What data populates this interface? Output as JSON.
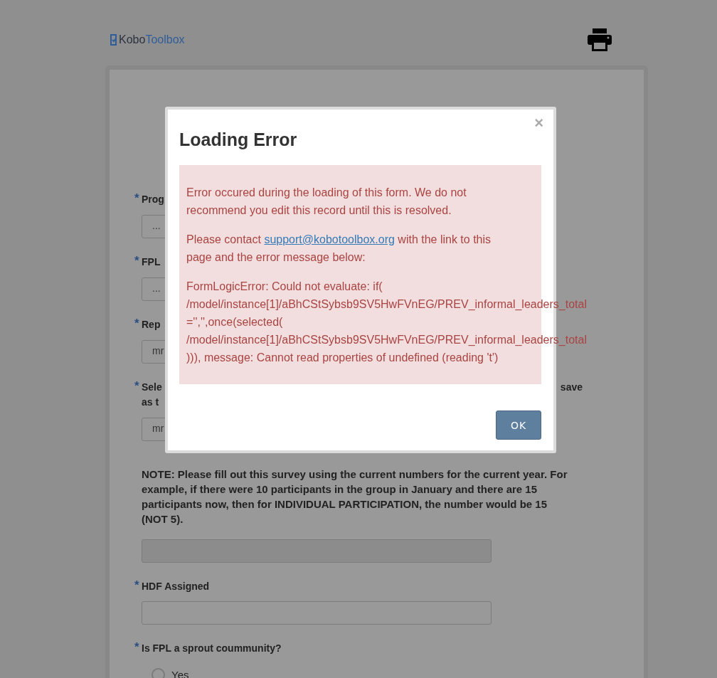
{
  "header": {
    "logo": {
      "part_1": "Kobo",
      "part_2": "Toolbox"
    }
  },
  "form": {
    "questions": [
      {
        "kind": "select",
        "required_mark": "*",
        "label_lines": [
          "Prog"
        ],
        "value": "..."
      },
      {
        "kind": "select",
        "required_mark": "*",
        "label_lines": [
          "FPL"
        ],
        "value": "..."
      },
      {
        "kind": "select",
        "required_mark": "*",
        "label_lines": [
          "Rep"
        ],
        "value": "mr"
      },
      {
        "kind": "select",
        "required_mark": "*",
        "label_lines": [
          "Sele",
          "as t"
        ],
        "label_right": "save",
        "value": "mr"
      },
      {
        "kind": "note",
        "label_lines": [
          "NOTE: Please fill out this survey using the current numbers for the current year. For example, if there were 10 participants in the group in January and there are 15 participants now, then for INDIVIDUAL PARTICIPATION, the number would be 15 (NOT 5)."
        ]
      },
      {
        "kind": "text",
        "required_mark": "*",
        "label_lines": [
          "HDF Assigned"
        ]
      },
      {
        "kind": "radio",
        "required_mark": "*",
        "label_lines": [
          "Is FPL a sprout coummunity?"
        ],
        "options": [
          {
            "label": "Yes",
            "selected": false
          }
        ]
      }
    ]
  },
  "dialog": {
    "title": "Loading Error",
    "close": "×",
    "paragraphs": [
      {
        "kind": "text",
        "text": "Error occured during the loading of this form. We do not recommend you edit this record until this is resolved."
      },
      {
        "kind": "link",
        "before": "Please contact ",
        "link": "support@kobotoolbox.org",
        "after": " with the link to this page and the error message below:"
      },
      {
        "kind": "code",
        "text": "FormLogicError: Could not evaluate: if( /model/instance[1]/aBhCStSybsb9SV5HwFVnEG/PREV_informal_leaders_total ='','',once(selected( /model/instance[1]/aBhCStSybsb9SV5HwFVnEG/PREV_informal_leaders_total ))), message: Cannot read properties of undefined (reading 't')"
      }
    ],
    "ok_button": "OK"
  }
}
